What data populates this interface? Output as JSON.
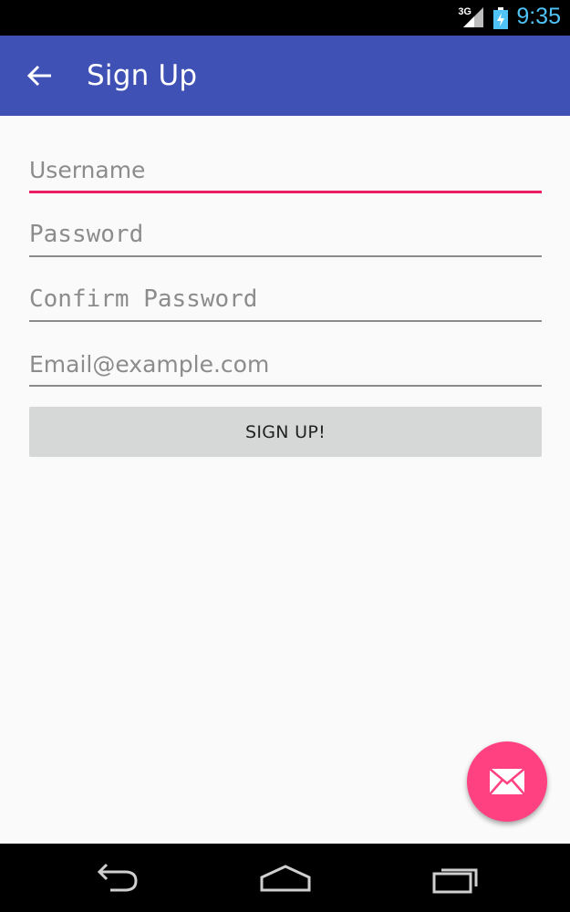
{
  "status_bar": {
    "network": "3G",
    "time": "9:35",
    "signal_icon": "signal-icon",
    "battery_icon": "battery-charging-icon",
    "time_color": "#4fc3f7"
  },
  "app_bar": {
    "title": "Sign Up",
    "back_icon": "arrow-back-icon",
    "color": "#3f51b5"
  },
  "form": {
    "username": {
      "value": "",
      "placeholder": "Username"
    },
    "password": {
      "value": "",
      "placeholder": "Password"
    },
    "confirm_password": {
      "value": "",
      "placeholder": "Confirm Password"
    },
    "email": {
      "value": "",
      "placeholder": "Email@example.com"
    },
    "submit_label": "SIGN UP!",
    "focus_color": "#e91e63"
  },
  "fab": {
    "icon": "email-icon",
    "color": "#ff4081"
  },
  "nav_bar": {
    "back_icon": "nav-back-icon",
    "home_icon": "nav-home-icon",
    "recents_icon": "nav-recents-icon"
  }
}
